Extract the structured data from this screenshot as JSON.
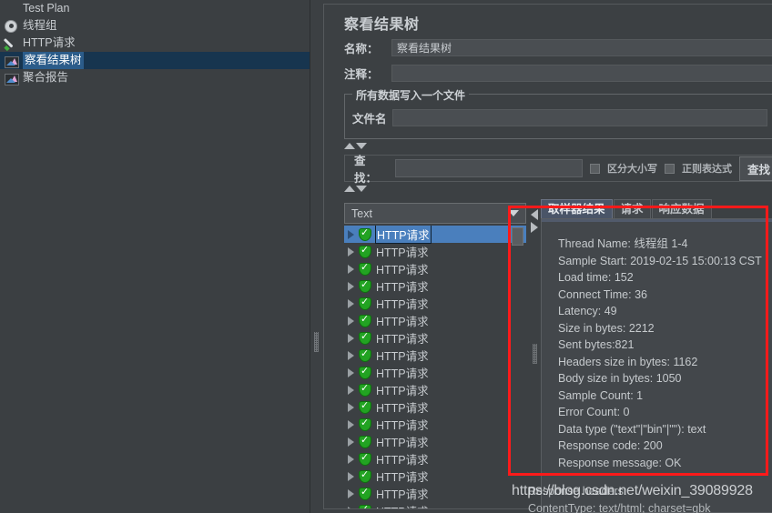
{
  "sidebar": {
    "items": [
      {
        "label": "Test Plan",
        "icon": "none",
        "selected": false,
        "indent": 0
      },
      {
        "label": "线程组",
        "icon": "gear-icon",
        "selected": false,
        "indent": 0
      },
      {
        "label": "HTTP请求",
        "icon": "pen-icon",
        "selected": false,
        "indent": 0
      },
      {
        "label": "察看结果树",
        "icon": "chart-icon",
        "selected": true,
        "indent": 0
      },
      {
        "label": "聚合报告",
        "icon": "chart-icon",
        "selected": false,
        "indent": 0
      }
    ]
  },
  "panel": {
    "title": "察看结果树",
    "name_label": "名称：",
    "name_value": "察看结果树",
    "comment_label": "注释：",
    "comment_value": "",
    "filegroup": {
      "legend": "所有数据写入一个文件",
      "filename_label": "文件名",
      "filename_value": ""
    },
    "search": {
      "label": "查找：",
      "value": "",
      "case_sensitive_label": "区分大小写",
      "case_sensitive_checked": false,
      "regex_label": "正则表达式",
      "regex_checked": false,
      "find_button": "查找"
    },
    "renderer": {
      "selected": "Text"
    }
  },
  "results": {
    "rows": [
      {
        "label": "HTTP请求",
        "status": "success",
        "selected": true
      },
      {
        "label": "HTTP请求",
        "status": "success",
        "selected": false
      },
      {
        "label": "HTTP请求",
        "status": "success",
        "selected": false
      },
      {
        "label": "HTTP请求",
        "status": "success",
        "selected": false
      },
      {
        "label": "HTTP请求",
        "status": "success",
        "selected": false
      },
      {
        "label": "HTTP请求",
        "status": "success",
        "selected": false
      },
      {
        "label": "HTTP请求",
        "status": "success",
        "selected": false
      },
      {
        "label": "HTTP请求",
        "status": "success",
        "selected": false
      },
      {
        "label": "HTTP请求",
        "status": "success",
        "selected": false
      },
      {
        "label": "HTTP请求",
        "status": "success",
        "selected": false
      },
      {
        "label": "HTTP请求",
        "status": "success",
        "selected": false
      },
      {
        "label": "HTTP请求",
        "status": "success",
        "selected": false
      },
      {
        "label": "HTTP请求",
        "status": "success",
        "selected": false
      },
      {
        "label": "HTTP请求",
        "status": "success",
        "selected": false
      },
      {
        "label": "HTTP请求",
        "status": "success",
        "selected": false
      },
      {
        "label": "HTTP请求",
        "status": "success",
        "selected": false
      },
      {
        "label": "HTTP请求",
        "status": "success",
        "selected": false
      }
    ]
  },
  "detail": {
    "tabs": [
      {
        "label": "取样器结果",
        "active": true
      },
      {
        "label": "请求",
        "active": false
      },
      {
        "label": "响应数据",
        "active": false
      }
    ],
    "lines": [
      "Thread Name: 线程组 1-4",
      "Sample Start: 2019-02-15 15:00:13 CST",
      "Load time: 152",
      "Connect Time: 36",
      "Latency: 49",
      "Size in bytes: 2212",
      "Sent bytes:821",
      "Headers size in bytes: 1162",
      "Body size in bytes: 1050",
      "Sample Count: 1",
      "Error Count: 0",
      "Data type (\"text\"|\"bin\"|\"\"): text",
      "Response code: 200",
      "Response message: OK"
    ],
    "hidden_lines": [
      "Response headers:",
      "ContentType: text/html; charset=gbk"
    ]
  },
  "annotation": {
    "highlight_color": "#ff1a1a"
  },
  "watermark": {
    "text": "https://blog.csdn.net/weixin_39089928"
  }
}
